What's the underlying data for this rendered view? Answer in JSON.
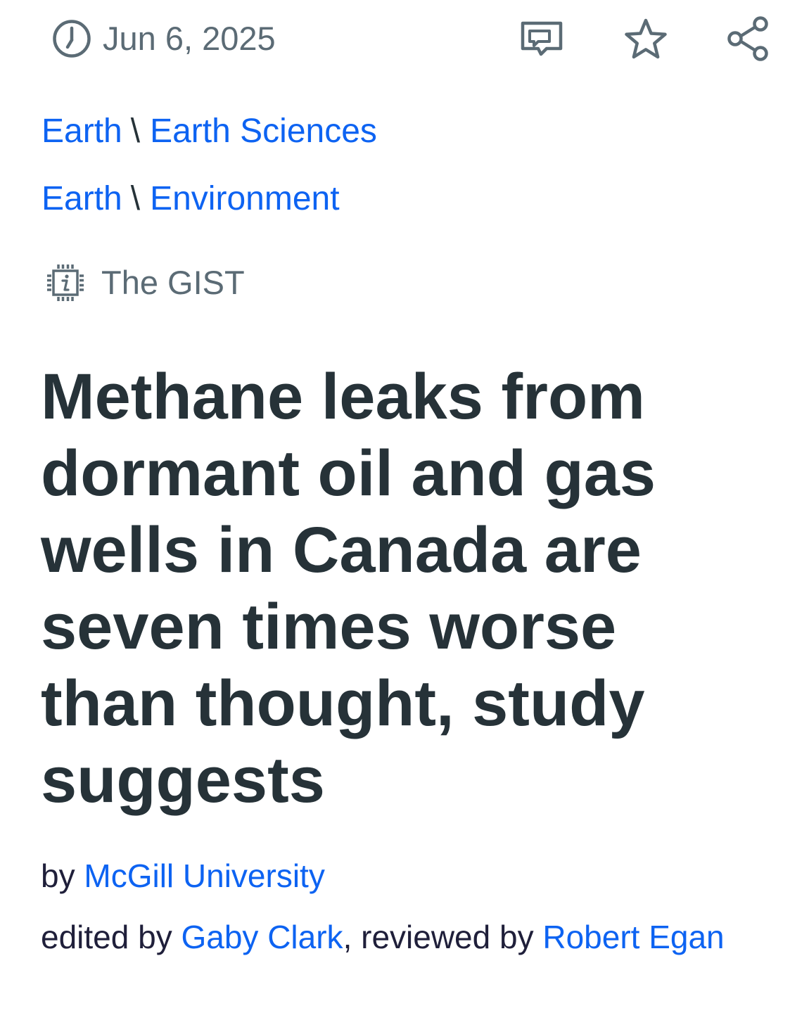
{
  "meta": {
    "date": "Jun 6, 2025"
  },
  "icons": {
    "date": "clock-icon",
    "comments": "comments-icon",
    "bookmark": "star-icon",
    "share": "share-icon",
    "gist": "chip-info-icon"
  },
  "colors": {
    "link": "#0d63f2",
    "muted": "#5b6b75",
    "heading": "#263238"
  },
  "breadcrumbs": [
    {
      "parent": "Earth",
      "separator": "\\",
      "child": "Earth Sciences"
    },
    {
      "parent": "Earth",
      "separator": "\\",
      "child": "Environment"
    }
  ],
  "gist": {
    "label": "The GIST"
  },
  "article": {
    "headline": "Methane leaks from dormant oil and gas wells in Canada are seven times worse than thought, study suggests"
  },
  "byline": {
    "prefix": "by",
    "author": "McGill University"
  },
  "credits": {
    "edited_prefix": "edited by",
    "editor": "Gaby Clark",
    "reviewed_prefix": ", reviewed by",
    "reviewer": "Robert Egan"
  }
}
